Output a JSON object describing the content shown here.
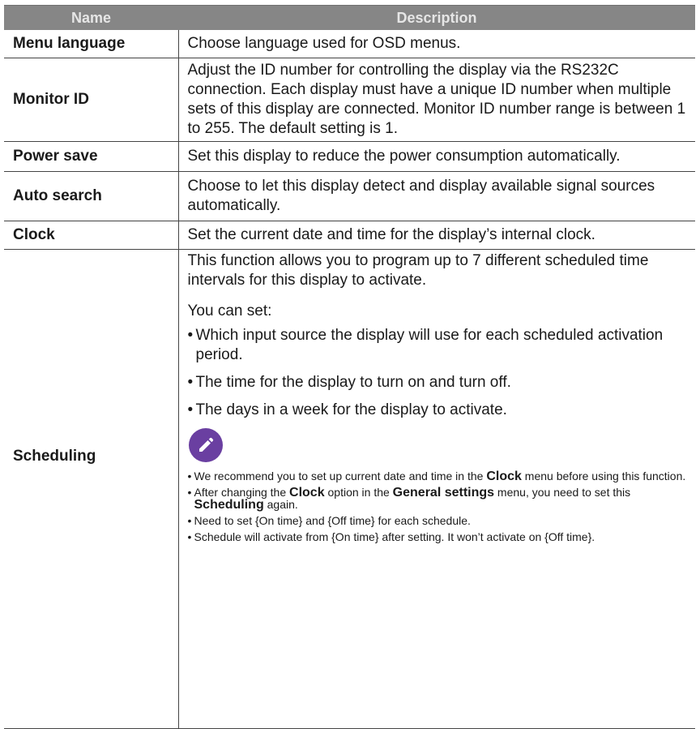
{
  "header": {
    "name": "Name",
    "description": "Description"
  },
  "rows": [
    {
      "name": "Menu language",
      "description": "Choose language used for OSD menus."
    },
    {
      "name": "Monitor ID",
      "description": "Adjust the ID number for controlling the display via the RS232C connection. Each display must have a unique ID number when multiple sets of this display are connected. Monitor ID number range is between 1 to 255. The default setting is 1."
    },
    {
      "name": "Power save",
      "description": "Set this display to reduce the power consumption automatically."
    },
    {
      "name": "Auto search",
      "description": "Choose to let this display detect and display available signal sources automatically."
    },
    {
      "name": "Clock",
      "description": "Set the current date and time for the display’s internal clock."
    }
  ],
  "scheduling": {
    "name": "Scheduling",
    "intro": "This function allows you to program up to 7 different scheduled time intervals for this display to activate.",
    "you_can_set": "You can set:",
    "items": [
      "Which input source the display will use for each scheduled activation period.",
      "The time for the display to turn on and turn off.",
      "The days in a week for the display to activate."
    ],
    "bullet": "•",
    "note_icon": "pencil-icon",
    "note_color": "#6a3fa1",
    "notes": {
      "n1_a": "We recommend you to set up current date and time in the ",
      "n1_b": "Clock",
      "n1_c": " menu before using this function.",
      "n2_a": "After changing the ",
      "n2_b": "Clock",
      "n2_c": " option in the ",
      "n2_d": "General settings",
      "n2_e": " menu, you need to set this ",
      "n2_f": "Scheduling",
      "n2_g": " again.",
      "n3": "Need to set {On time} and {Off time} for each schedule.",
      "n4": "Schedule will activate from {On time} after setting. It won’t activate on {Off time}."
    }
  }
}
